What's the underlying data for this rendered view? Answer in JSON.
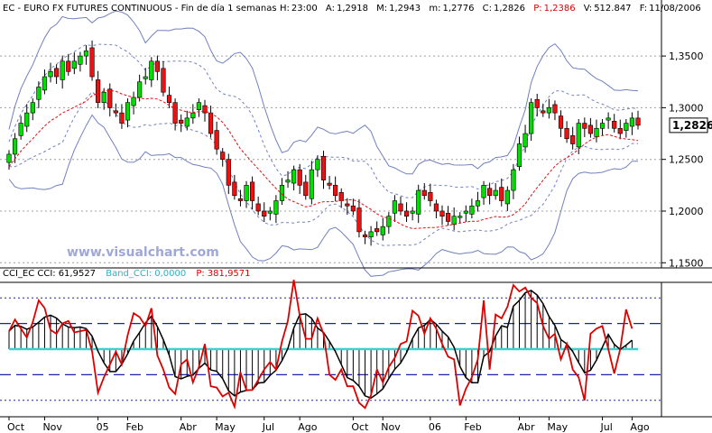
{
  "header": {
    "title": "EC - EURO FX FUTURES CONTINUOUS - Fin de día 1 semanas",
    "high_label": "H:",
    "high_value": "23:00",
    "open_label": "A:",
    "open_value": "1,2918",
    "max_label": "M:",
    "max_value": "1,2943",
    "min_label": "m:",
    "min_value": "1,2776",
    "close_label": "C:",
    "close_value": "1,2826",
    "p_label": "P:",
    "p_value": "1,2386",
    "vol_label": "V:",
    "vol_value": "512.847",
    "date_label": "F:",
    "date_value": "11/08/2006"
  },
  "watermark": "www.visualchart.com",
  "indicator_header": {
    "cci_label": "CCI_EC  CCI:",
    "cci_value": "61,9527",
    "band_label": "Band_CCI:",
    "band_value": "0,0000",
    "p_label": "P:",
    "p_value": "381,9571"
  },
  "colors": {
    "up": "#00dd00",
    "down": "#ee1111",
    "bands": "#7080c0",
    "ma": "#dd1111",
    "cci": "#dd0000",
    "cci_avg": "#000000",
    "band": "#40d0d0",
    "dashed": "#2020aa"
  },
  "chart_data": [
    {
      "type": "candlestick",
      "title": "EC - EURO FX FUTURES CONTINUOUS",
      "y_ticks": [
        "1,1500",
        "1,2000",
        "1,2500",
        "1,3000",
        "1,3500"
      ],
      "y_tick_values": [
        1.15,
        1.2,
        1.25,
        1.3,
        1.35
      ],
      "ylim": [
        1.145,
        1.385
      ],
      "last_value_label": "1,2826",
      "x_ticks": [
        "Oct",
        "Nov",
        "05",
        "Feb",
        "Abr",
        "May",
        "Jul",
        "Ago",
        "Oct",
        "Nov",
        "06",
        "Feb",
        "Abr",
        "May",
        "Jul",
        "Ago"
      ],
      "x_tick_index": [
        0,
        6,
        15,
        20,
        29,
        35,
        43,
        49,
        58,
        63,
        71,
        77,
        86,
        91,
        100,
        105
      ],
      "close": [
        1.255,
        1.27,
        1.285,
        1.295,
        1.305,
        1.32,
        1.33,
        1.335,
        1.33,
        1.345,
        1.335,
        1.345,
        1.35,
        1.355,
        1.33,
        1.305,
        1.315,
        1.3,
        1.295,
        1.285,
        1.305,
        1.31,
        1.325,
        1.33,
        1.345,
        1.335,
        1.315,
        1.305,
        1.285,
        1.285,
        1.29,
        1.295,
        1.305,
        1.295,
        1.275,
        1.26,
        1.25,
        1.225,
        1.215,
        1.21,
        1.225,
        1.21,
        1.2,
        1.195,
        1.2,
        1.21,
        1.225,
        1.23,
        1.24,
        1.225,
        1.215,
        1.24,
        1.25,
        1.23,
        1.225,
        1.215,
        1.21,
        1.205,
        1.2,
        1.18,
        1.175,
        1.18,
        1.18,
        1.185,
        1.195,
        1.21,
        1.2,
        1.195,
        1.2,
        1.22,
        1.215,
        1.21,
        1.2,
        1.195,
        1.19,
        1.195,
        1.195,
        1.2,
        1.205,
        1.21,
        1.225,
        1.215,
        1.22,
        1.21,
        1.22,
        1.24,
        1.265,
        1.275,
        1.305,
        1.3,
        1.295,
        1.3,
        1.295,
        1.28,
        1.27,
        1.265,
        1.285,
        1.28,
        1.275,
        1.28,
        1.285,
        1.29,
        1.28,
        1.275,
        1.285,
        1.29,
        1.283
      ],
      "series": [
        {
          "name": "CCI_EC",
          "color": "#dd0000"
        },
        {
          "name": "Band_CCI",
          "color": "#40d0d0"
        }
      ]
    },
    {
      "type": "line",
      "title": "CCI_EC",
      "ylim": [
        -250,
        250
      ],
      "band_level": 0,
      "dashed_levels": [
        100,
        -100
      ],
      "dotted_levels": [
        200,
        -200
      ],
      "cci": [
        70,
        115,
        80,
        45,
        105,
        190,
        160,
        75,
        60,
        100,
        110,
        65,
        70,
        75,
        -10,
        -170,
        -110,
        -60,
        -10,
        -60,
        55,
        140,
        125,
        90,
        160,
        -25,
        -80,
        -150,
        -175,
        -60,
        -40,
        -130,
        -70,
        20,
        -145,
        -150,
        -185,
        -170,
        -225,
        -90,
        -160,
        -160,
        -120,
        -80,
        -50,
        -80,
        30,
        110,
        270,
        130,
        40,
        40,
        120,
        60,
        -100,
        -120,
        -80,
        -145,
        -145,
        -210,
        -230,
        -180,
        -80,
        -130,
        -70,
        -35,
        20,
        30,
        150,
        130,
        60,
        120,
        80,
        20,
        -30,
        -40,
        -220,
        -155,
        -110,
        -40,
        190,
        -80,
        135,
        120,
        165,
        250,
        225,
        240,
        200,
        180,
        90,
        40,
        60,
        -40,
        20,
        -80,
        -110,
        -200,
        60,
        80,
        90,
        0,
        -95,
        0,
        155,
        80
      ]
    }
  ]
}
